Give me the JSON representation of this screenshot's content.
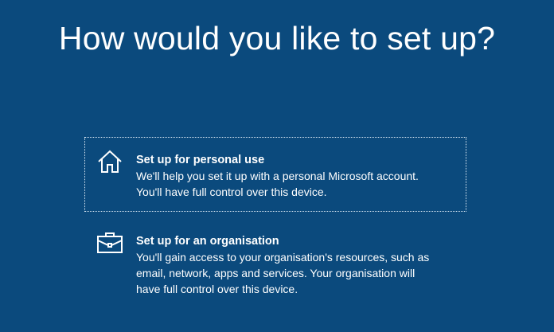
{
  "page": {
    "title": "How would you like to set up?"
  },
  "options": [
    {
      "icon": "home-icon",
      "title": "Set up for personal use",
      "description_lines": [
        "We'll help you set it up with a personal Microsoft account.",
        "You'll have full control over this device."
      ],
      "selected": true
    },
    {
      "icon": "briefcase-icon",
      "title": "Set up for an organisation",
      "description_lines": [
        "You'll gain access to your organisation's resources, such as",
        "email, network, apps and services. Your organisation will",
        "have full control over this device."
      ],
      "selected": false
    }
  ],
  "colors": {
    "background": "#0b4a7d",
    "text": "#ffffff",
    "focus_border": "#d9e6f2"
  }
}
